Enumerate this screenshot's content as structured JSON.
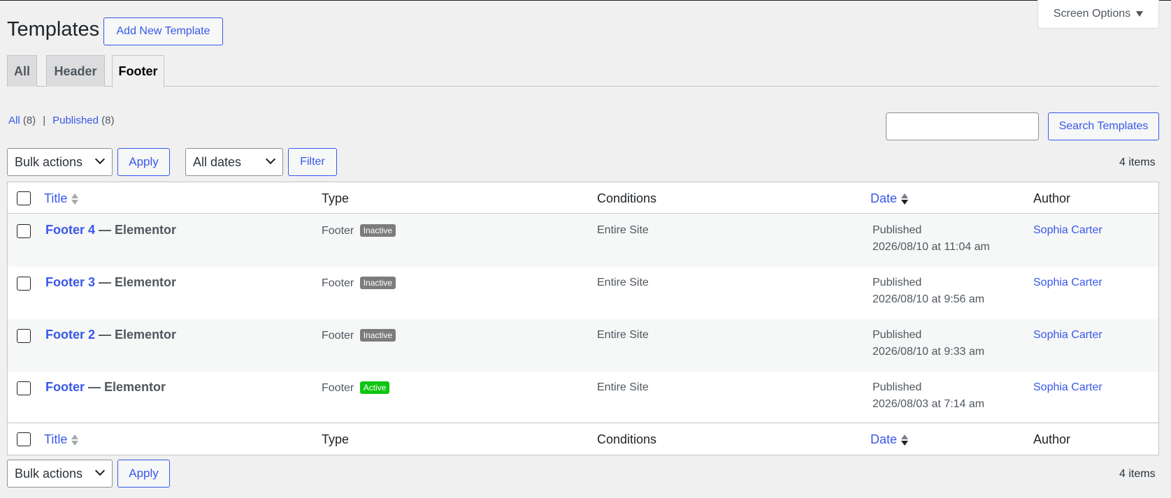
{
  "screen_options": {
    "label": "Screen Options"
  },
  "header": {
    "title": "Templates",
    "add_new_label": "Add New Template"
  },
  "tabs": [
    {
      "label": "All"
    },
    {
      "label": "Header"
    },
    {
      "label": "Footer"
    }
  ],
  "views": {
    "all_label": "All",
    "all_count": "(8)",
    "separator": "|",
    "published_label": "Published",
    "published_count": "(8)"
  },
  "search": {
    "value": "",
    "button_label": "Search Templates"
  },
  "tablenav_top": {
    "bulk_actions": "Bulk actions",
    "apply_label": "Apply",
    "dates": "All dates",
    "filter_label": "Filter",
    "items_count": "4 items"
  },
  "tablenav_bottom": {
    "bulk_actions": "Bulk actions",
    "apply_label": "Apply",
    "items_count": "4 items"
  },
  "columns": {
    "title": "Title",
    "type": "Type",
    "conditions": "Conditions",
    "date": "Date",
    "author": "Author"
  },
  "rows": [
    {
      "title": "Footer 4",
      "suffix": "— Elementor",
      "type": "Footer",
      "status_badge": "Inactive",
      "conditions": "Entire Site",
      "date_status": "Published",
      "date": "2026/08/10 at 11:04 am",
      "author": "Sophia Carter"
    },
    {
      "title": "Footer 3",
      "suffix": "— Elementor",
      "type": "Footer",
      "status_badge": "Inactive",
      "conditions": "Entire Site",
      "date_status": "Published",
      "date": "2026/08/10 at 9:56 am",
      "author": "Sophia Carter"
    },
    {
      "title": "Footer 2",
      "suffix": "— Elementor",
      "type": "Footer",
      "status_badge": "Inactive",
      "conditions": "Entire Site",
      "date_status": "Published",
      "date": "2026/08/10 at 9:33 am",
      "author": "Sophia Carter"
    },
    {
      "title": "Footer",
      "suffix": "— Elementor",
      "type": "Footer",
      "status_badge": "Active",
      "conditions": "Entire Site",
      "date_status": "Published",
      "date": "2026/08/03 at 7:14 am",
      "author": "Sophia Carter"
    }
  ],
  "colors": {
    "link": "#3858e9",
    "active_badge": "#0ec510",
    "inactive_badge": "#7c7c7c"
  }
}
